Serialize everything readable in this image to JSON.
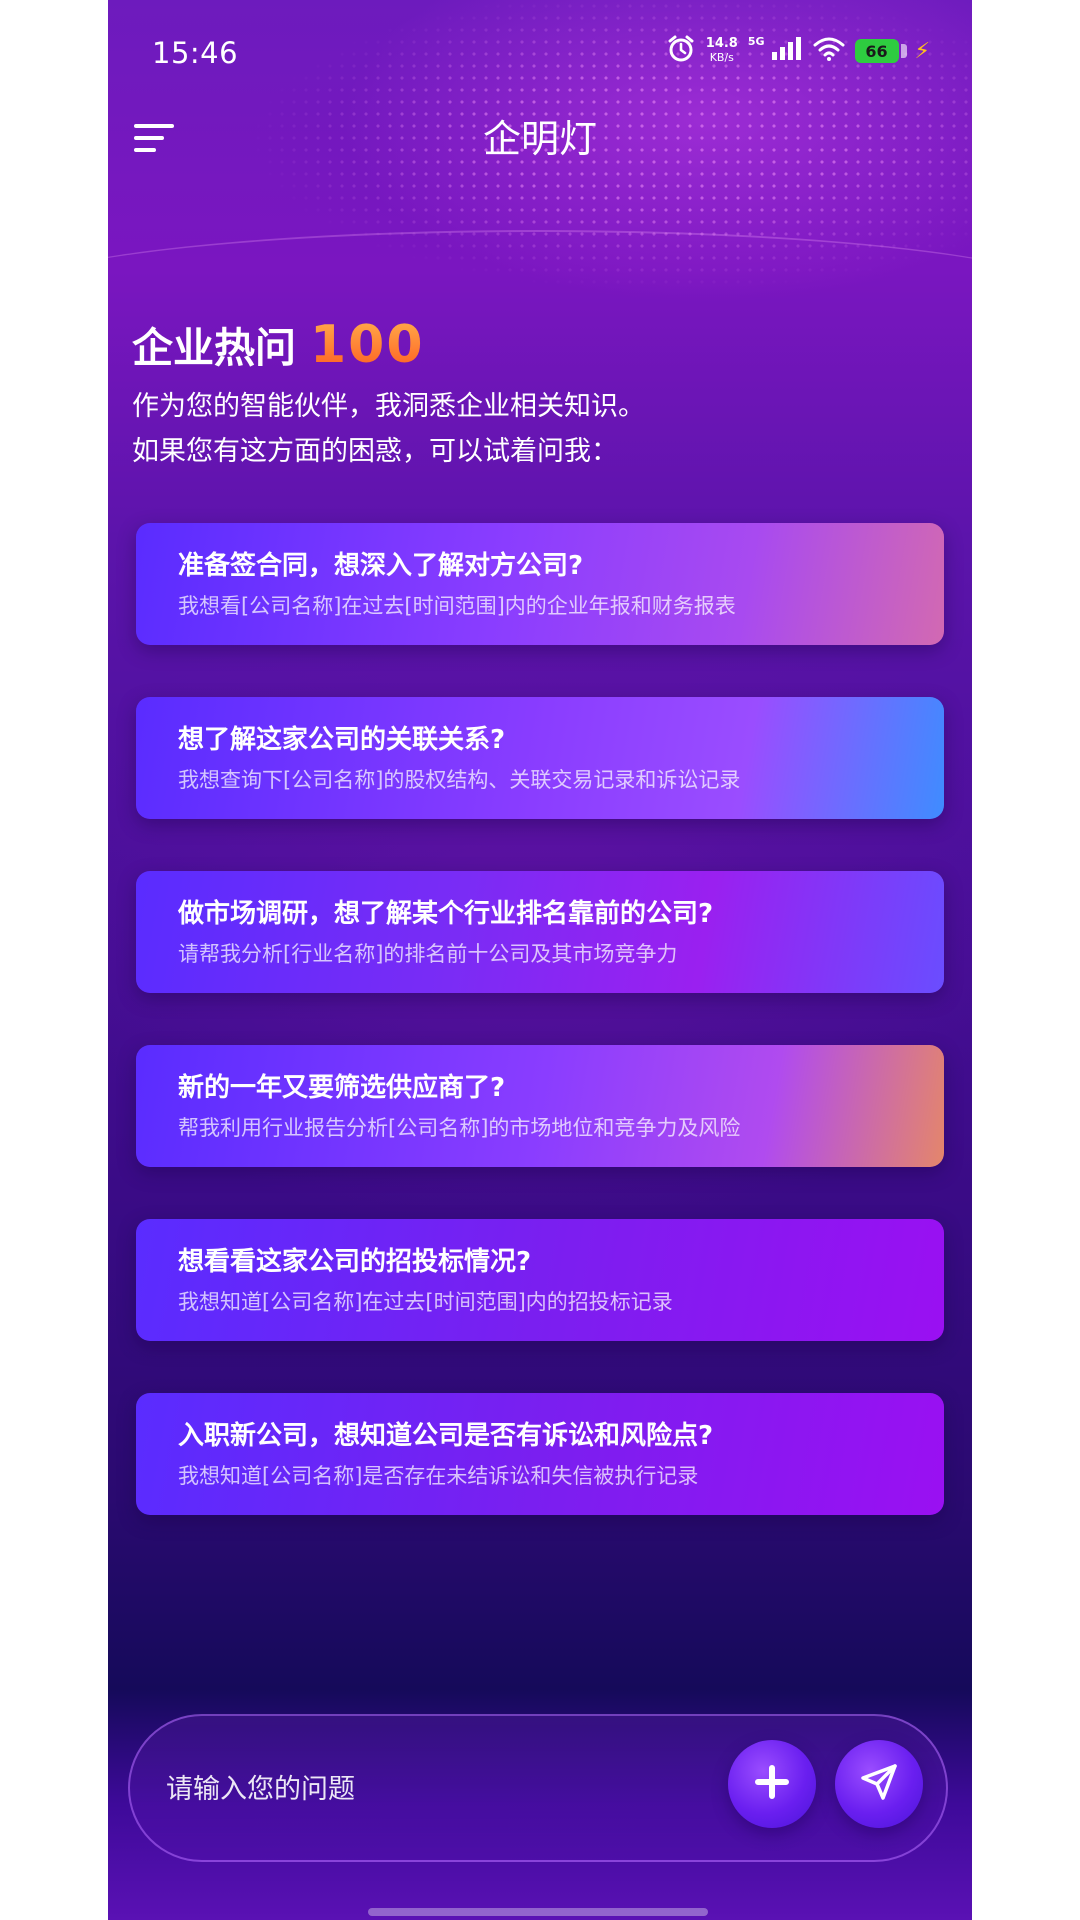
{
  "status_bar": {
    "time": "15:46",
    "net_speed_value": "14.8",
    "net_speed_unit": "KB/s",
    "network_type": "5G",
    "battery_level": "66",
    "icons": [
      "alarm-icon",
      "signal-icon",
      "wifi-icon",
      "battery-icon",
      "charging-icon"
    ]
  },
  "header": {
    "title": "企明灯",
    "menu_icon": "menu-icon"
  },
  "hero": {
    "title": "企业热问",
    "number": "100",
    "desc_line1": "作为您的智能伙伴，我洞悉企业相关知识。",
    "desc_line2": "如果您有这方面的困惑，可以试着问我："
  },
  "cards": [
    {
      "question": "准备签合同，想深入了解对方公司?",
      "prompt": "我想看[公司名称]在过去[时间范围]内的企业年报和财务报表"
    },
    {
      "question": "想了解这家公司的关联关系?",
      "prompt": "我想查询下[公司名称]的股权结构、关联交易记录和诉讼记录"
    },
    {
      "question": "做市场调研，想了解某个行业排名靠前的公司?",
      "prompt": "请帮我分析[行业名称]的排名前十公司及其市场竞争力"
    },
    {
      "question": "新的一年又要筛选供应商了?",
      "prompt": "帮我利用行业报告分析[公司名称]的市场地位和竞争力及风险"
    },
    {
      "question": "想看看这家公司的招投标情况?",
      "prompt": "我想知道[公司名称]在过去[时间范围]内的招投标记录"
    },
    {
      "question": "入职新公司，想知道公司是否有诉讼和风险点?",
      "prompt": "我想知道[公司名称]是否存在未结诉讼和失信被执行记录"
    }
  ],
  "input": {
    "placeholder": "请输入您的问题",
    "value": "",
    "add_icon": "plus-icon",
    "send_icon": "send-icon"
  },
  "colors": {
    "accent": "#7a2cff",
    "number_gradient_top": "#ffb04d",
    "number_gradient_bottom": "#ff5a1f",
    "battery": "#2ecc40"
  }
}
